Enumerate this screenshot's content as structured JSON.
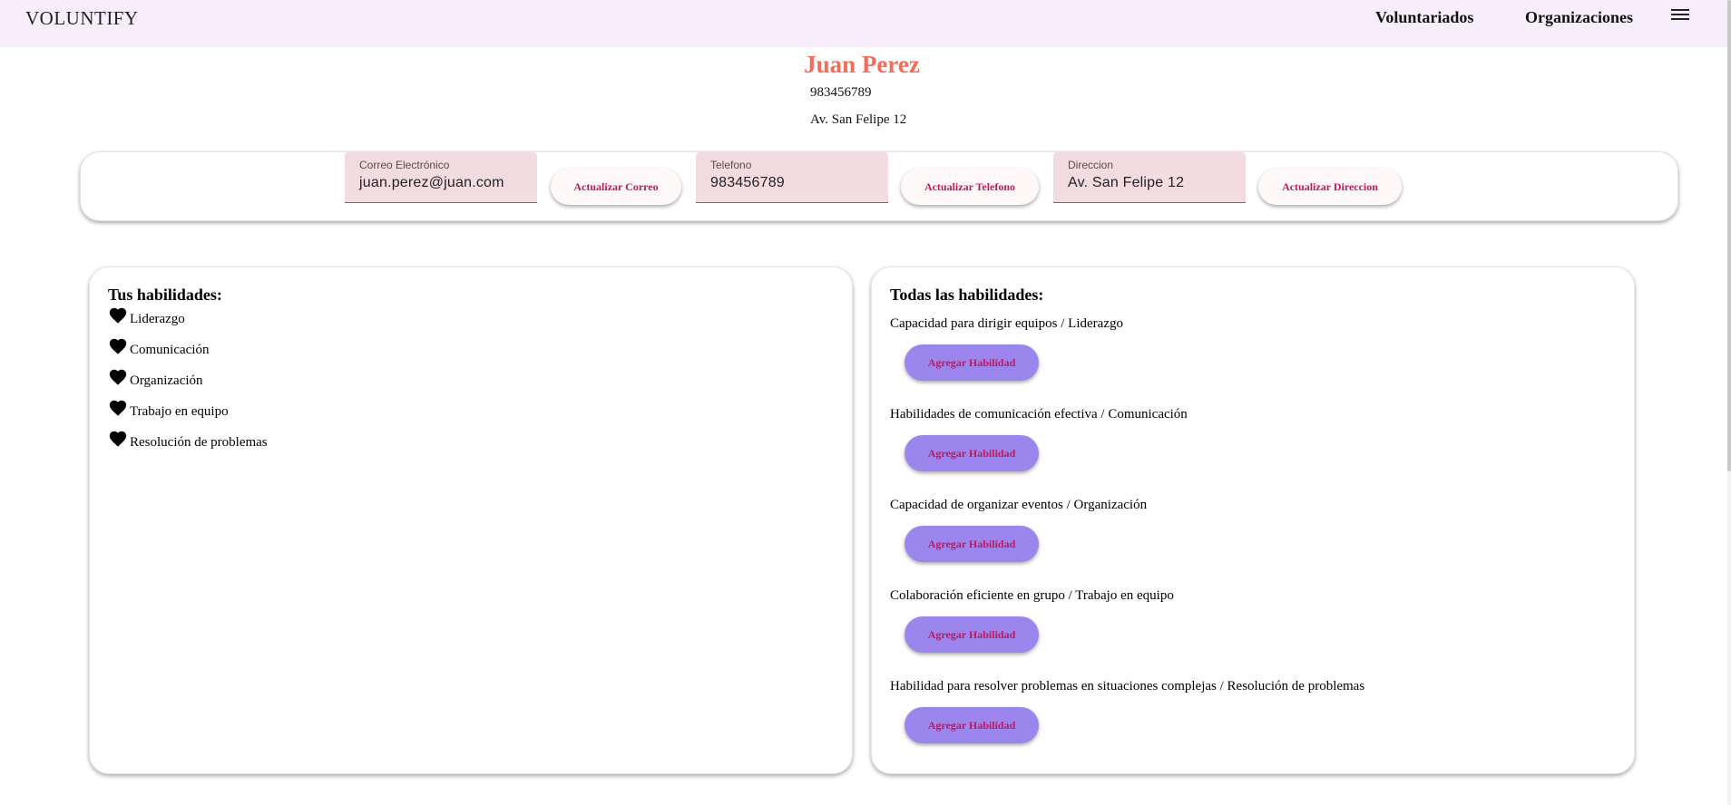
{
  "header": {
    "brand": "VOLUNTIFY",
    "nav": [
      "Voluntariados",
      "Organizaciones"
    ],
    "menu_icon": "hamburger-menu-icon"
  },
  "profile": {
    "name": "Juan Perez",
    "phone": "983456789",
    "address": "Av. San Felipe 12"
  },
  "update_form": {
    "email": {
      "label": "Correo Electrónico",
      "value": "juan.perez@juan.com",
      "button": "Actualizar Correo"
    },
    "phone": {
      "label": "Telefono",
      "value": "983456789",
      "button": "Actualizar Telefono"
    },
    "address": {
      "label": "Direccion",
      "value": "Av. San Felipe 12",
      "button": "Actualizar Direccion"
    }
  },
  "my_skills": {
    "title": "Tus habilidades:",
    "icon": "heart-icon",
    "items": [
      "Liderazgo",
      "Comunicación",
      "Organización",
      "Trabajo en equipo",
      "Resolución de problemas"
    ]
  },
  "all_skills": {
    "title": "Todas las habilidades:",
    "button_label": "Agregar Habilidad",
    "items": [
      "Capacidad para dirigir equipos / Liderazgo",
      "Habilidades de comunicación efectiva / Comunicación",
      "Capacidad de organizar eventos / Organización",
      "Colaboración eficiente en grupo / Trabajo en equipo",
      "Habilidad para resolver problemas en situaciones complejas / Resolución de problemas"
    ]
  },
  "colors": {
    "topbar": "#f6eefa",
    "name": "#f26c5a",
    "field_bg": "#f3dce1",
    "add_button": "#9b86ee",
    "button_text": "#c2185b"
  }
}
